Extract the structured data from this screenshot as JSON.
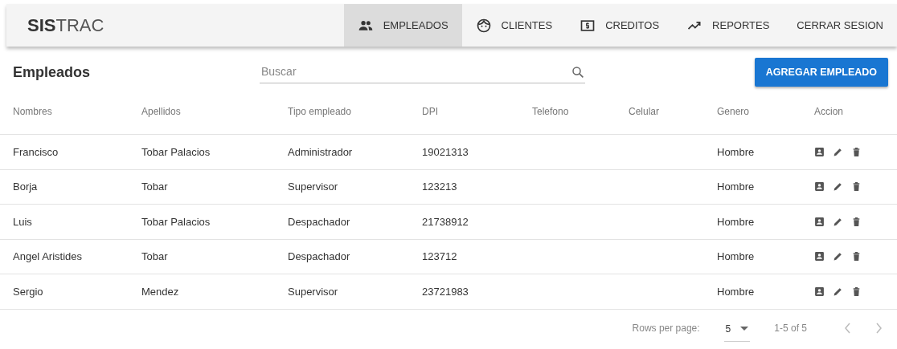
{
  "app": {
    "logo": "**SIS**TRAC"
  },
  "nav": [
    {
      "label": "EMPLEADOS",
      "selected": true
    },
    {
      "label": "CLIENTES",
      "selected": false
    },
    {
      "label": "CREDITOS",
      "selected": false
    },
    {
      "label": "REPORTES",
      "selected": false
    },
    {
      "label": "CERRAR SESION",
      "selected": false
    }
  ],
  "page": {
    "title": "Empleados",
    "search": {
      "placeholder": "Buscar"
    },
    "add_button": "AGREGAR EMPLEADO"
  },
  "table": {
    "columns": [
      "Nombres",
      "Apellidos",
      "Tipo empleado",
      "DPI",
      "Telefono",
      "Celular",
      "Genero",
      "Accion"
    ],
    "rows": [
      [
        "Francisco",
        "Tobar Palacios",
        "Administrador",
        "19021313",
        "",
        "",
        "Hombre"
      ],
      [
        "Borja",
        "Tobar",
        "Supervisor",
        "123213",
        "",
        "",
        "Hombre"
      ],
      [
        "Luis",
        "Tobar Palacios",
        "Despachador",
        "21738912",
        "",
        "",
        "Hombre"
      ],
      [
        "Angel Aristides",
        "Tobar",
        "Despachador",
        "123712",
        "",
        "",
        "Hombre"
      ],
      [
        "Sergio",
        "Mendez",
        "Supervisor",
        "23721983",
        "",
        "",
        "Hombre"
      ]
    ]
  },
  "pagination": {
    "rows_per_page_label": "Rows per page:",
    "rows_per_page": "5",
    "range": "1-5 of 5",
    "prev_disabled": true,
    "next_disabled": true
  }
}
